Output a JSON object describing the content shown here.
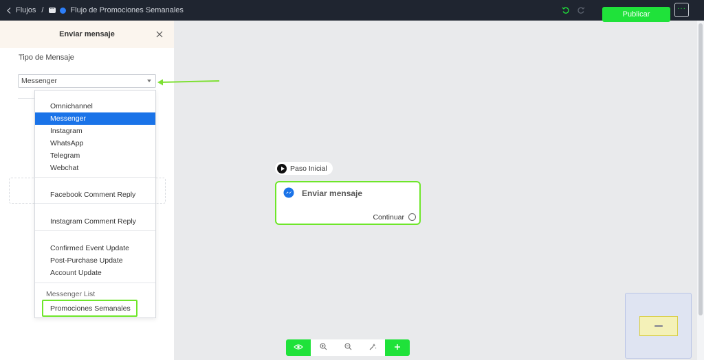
{
  "topbar": {
    "back_label": "Flujos",
    "separator": "/",
    "flow_name": "Flujo de Promociones Semanales",
    "publish_label": "Publicar",
    "more_label": "···"
  },
  "panel": {
    "title": "Enviar mensaje",
    "field_label": "Tipo de Mensaje",
    "select_value": "Messenger"
  },
  "dropdown": {
    "options": [
      "Omnichannel",
      "Messenger",
      "Instagram",
      "WhatsApp",
      "Telegram",
      "Webchat",
      "Facebook Comment Reply",
      "Instagram Comment Reply",
      "Confirmed Event Update",
      "Post-Purchase Update",
      "Account Update"
    ],
    "selected": "Messenger",
    "group_label": "Messenger List",
    "group_item": "Promociones Semanales"
  },
  "canvas": {
    "start_label": "Paso Inicial",
    "node_title": "Enviar mensaje",
    "node_continue": "Continuar"
  },
  "colors": {
    "accent": "#1fe23a",
    "selected_blue": "#1a73e8",
    "node_border": "#6ee62a",
    "topbar": "#1f2530"
  },
  "icons": {
    "back": "chevron-left-icon",
    "flow": "chat-icon",
    "undo": "undo-icon",
    "redo": "redo-icon",
    "close": "close-icon",
    "node": "messenger-icon",
    "toolbar": [
      "eye-icon",
      "zoom-in-icon",
      "zoom-out-icon",
      "magic-wand-icon",
      "plus-icon"
    ]
  }
}
